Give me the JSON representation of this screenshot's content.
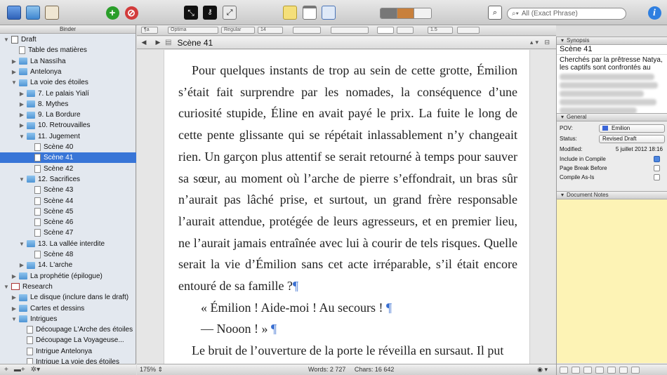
{
  "toolbar": {
    "search_placeholder": "All (Exact Phrase)",
    "colors": {
      "add": "#2a9e2a",
      "remove": "#d23b3b",
      "info": "#2f7fe0",
      "composition": "#000000"
    }
  },
  "binder": {
    "header": "Binder",
    "items": [
      {
        "label": "Draft",
        "indent": 0,
        "icon": "draft",
        "expanded": true
      },
      {
        "label": "Table des matières",
        "indent": 1,
        "icon": "doc"
      },
      {
        "label": "La Nassïha",
        "indent": 1,
        "icon": "folder",
        "collapsed": true
      },
      {
        "label": "Antelonya",
        "indent": 1,
        "icon": "folder",
        "collapsed": true
      },
      {
        "label": "La voie des étoiles",
        "indent": 1,
        "icon": "folder",
        "expanded": true
      },
      {
        "label": "7. Le palais Yialí",
        "indent": 2,
        "icon": "folder",
        "collapsed": true
      },
      {
        "label": "8. Mythes",
        "indent": 2,
        "icon": "folder",
        "collapsed": true
      },
      {
        "label": "9. La Bordure",
        "indent": 2,
        "icon": "folder",
        "collapsed": true
      },
      {
        "label": "10. Retrouvailles",
        "indent": 2,
        "icon": "folder",
        "collapsed": true
      },
      {
        "label": "11. Jugement",
        "indent": 2,
        "icon": "folder",
        "expanded": true
      },
      {
        "label": "Scène 40",
        "indent": 3,
        "icon": "doc"
      },
      {
        "label": "Scène 41",
        "indent": 3,
        "icon": "doc",
        "selected": true
      },
      {
        "label": "Scène 42",
        "indent": 3,
        "icon": "doc"
      },
      {
        "label": "12. Sacrifices",
        "indent": 2,
        "icon": "folder",
        "expanded": true
      },
      {
        "label": "Scène 43",
        "indent": 3,
        "icon": "doc"
      },
      {
        "label": "Scène 44",
        "indent": 3,
        "icon": "doc"
      },
      {
        "label": "Scène 45",
        "indent": 3,
        "icon": "doc"
      },
      {
        "label": "Scène 46",
        "indent": 3,
        "icon": "doc"
      },
      {
        "label": "Scène 47",
        "indent": 3,
        "icon": "doc"
      },
      {
        "label": "13. La vallée interdite",
        "indent": 2,
        "icon": "folder",
        "expanded": true
      },
      {
        "label": "Scène 48",
        "indent": 3,
        "icon": "doc"
      },
      {
        "label": "14. L'arche",
        "indent": 2,
        "icon": "folder",
        "collapsed": true
      },
      {
        "label": "La prophétie (épilogue)",
        "indent": 1,
        "icon": "folder",
        "collapsed": true
      },
      {
        "label": "Research",
        "indent": 0,
        "icon": "research",
        "expanded": true
      },
      {
        "label": "Le disque (inclure dans le draft)",
        "indent": 1,
        "icon": "folder",
        "collapsed": true
      },
      {
        "label": "Cartes et dessins",
        "indent": 1,
        "icon": "folder",
        "collapsed": true
      },
      {
        "label": "Intrigues",
        "indent": 1,
        "icon": "folder",
        "expanded": true
      },
      {
        "label": "Découpage L'Arche des étoiles",
        "indent": 2,
        "icon": "doc"
      },
      {
        "label": "Découpage La Voyageuse...",
        "indent": 2,
        "icon": "doc"
      },
      {
        "label": "Intrigue Antelonya",
        "indent": 2,
        "icon": "doc"
      },
      {
        "label": "Intrigue La voie des étoiles",
        "indent": 2,
        "icon": "doc"
      }
    ]
  },
  "formatbar": {
    "font": "Optima",
    "style": "Regular",
    "size": "14",
    "spacing": "1.5",
    "para_style": "¶a"
  },
  "editor": {
    "doc_title": "Scène 41",
    "paragraphs": [
      {
        "text": "Pour quelques instants de trop au sein de cette grotte, Émilion s’était fait surprendre par les nomades, la conséquence d’une curiosité stupide, Éline en avait payé le prix. La fuite le long de cette pente glissante qui se répétait inlassablement n’y changeait rien. Un garçon plus attentif se serait retourné à temps pour sauver sa sœur, au moment où l’arche de pierre s’effondrait, un bras sûr n’aurait pas lâché prise, et surtout, un grand frère responsable l’aurait attendue, protégée de leurs agresseurs, et en premier lieu, ne l’aurait jamais entraînée avec lui à courir de tels risques. Quelle serait la vie d’Émilion sans cet acte irréparable, s’il était encore entouré de sa famille ?",
        "pilcrow": "¶",
        "cls": ""
      },
      {
        "text": "« Émilion ! Aide-moi ! Au secours ! ",
        "pilcrow": "¶",
        "cls": "dlg"
      },
      {
        "text": "— Nooon ! » ",
        "pilcrow": "¶",
        "cls": "dlg"
      },
      {
        "text": "Le bruit de l’ouverture de la porte le réveilla en sursaut. Il put",
        "pilcrow": "",
        "cls": ""
      }
    ]
  },
  "footer": {
    "zoom": "175%",
    "words": "Words: 2 727",
    "chars": "Chars: 16 642"
  },
  "inspector": {
    "synopsis_header": "Synopsis",
    "synopsis_title": "Scène 41",
    "synopsis_text": "Cherchés par la prêtresse Natya, les captifs sont confrontés au",
    "general_header": "General",
    "pov_label": "POV:",
    "pov_value": "Emilion",
    "pov_color": "#3b66d8",
    "status_label": "Status:",
    "status_value": "Revised Draft",
    "modified_label": "Modified:",
    "modified_value": "5 juillet 2012 18:16",
    "include_label": "Include in Compile",
    "include_checked": true,
    "pagebreak_label": "Page Break Before",
    "pagebreak_checked": false,
    "compileasis_label": "Compile As-Is",
    "compileasis_checked": false,
    "notes_header": "Document Notes"
  }
}
